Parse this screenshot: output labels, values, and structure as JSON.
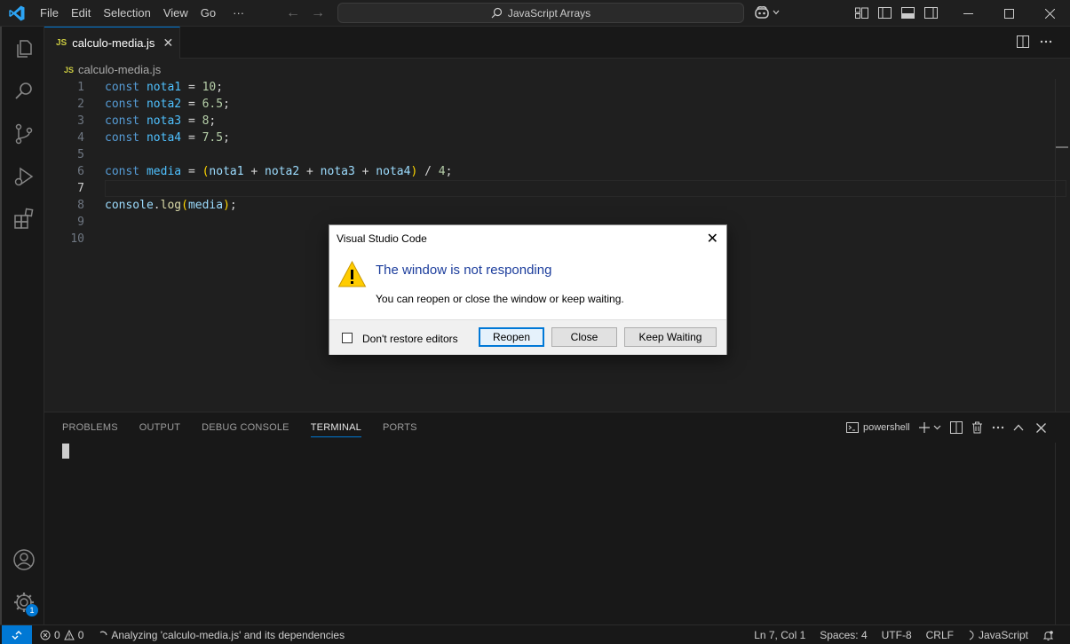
{
  "titlebar": {
    "menu": [
      "File",
      "Edit",
      "Selection",
      "View",
      "Go",
      "···"
    ],
    "search_text": "JavaScript Arrays"
  },
  "tab": {
    "lang_tag": "JS",
    "title": "calculo-media.js",
    "close": "✕"
  },
  "breadcrumb": {
    "lang_tag": "JS",
    "file": "calculo-media.js"
  },
  "editor": {
    "line_numbers": [
      "1",
      "2",
      "3",
      "4",
      "5",
      "6",
      "7",
      "8",
      "9",
      "10"
    ],
    "active_line": "7"
  },
  "code": {
    "l1": {
      "kw": "const",
      "var": "nota1",
      "op": "=",
      "num": "10",
      "end": ";"
    },
    "l2": {
      "kw": "const",
      "var": "nota2",
      "op": "=",
      "num": "6.5",
      "end": ";"
    },
    "l3": {
      "kw": "const",
      "var": "nota3",
      "op": "=",
      "num": "8",
      "end": ";"
    },
    "l4": {
      "kw": "const",
      "var": "nota4",
      "op": "=",
      "num": "7.5",
      "end": ";"
    },
    "l6": {
      "kw": "const",
      "var": "media",
      "op": "=",
      "a": "nota1",
      "b": "nota2",
      "c": "nota3",
      "d": "nota4",
      "div": "4"
    },
    "l8": {
      "obj": "console",
      "fn": "log",
      "arg": "media"
    }
  },
  "panel": {
    "tabs": [
      "PROBLEMS",
      "OUTPUT",
      "DEBUG CONSOLE",
      "TERMINAL",
      "PORTS"
    ],
    "active_tab": "TERMINAL",
    "shell": "powershell"
  },
  "statusbar": {
    "errors": "0",
    "warnings": "0",
    "analyzing": "Analyzing 'calculo-media.js' and its dependencies",
    "position": "Ln 7, Col 1",
    "spaces": "Spaces: 4",
    "encoding": "UTF-8",
    "eol": "CRLF",
    "language": "JavaScript"
  },
  "activity": {
    "badge": "1"
  },
  "dialog": {
    "title": "Visual Studio Code",
    "heading": "The window is not responding",
    "message": "You can reopen or close the window or keep waiting.",
    "checkbox_label": "Don't restore editors",
    "buttons": {
      "reopen": "Reopen",
      "close": "Close",
      "keep_waiting": "Keep Waiting"
    }
  },
  "colors": {
    "accent": "#0078d4",
    "editor_bg": "#1f1f1f",
    "dialog_heading": "#1c3d9c"
  }
}
